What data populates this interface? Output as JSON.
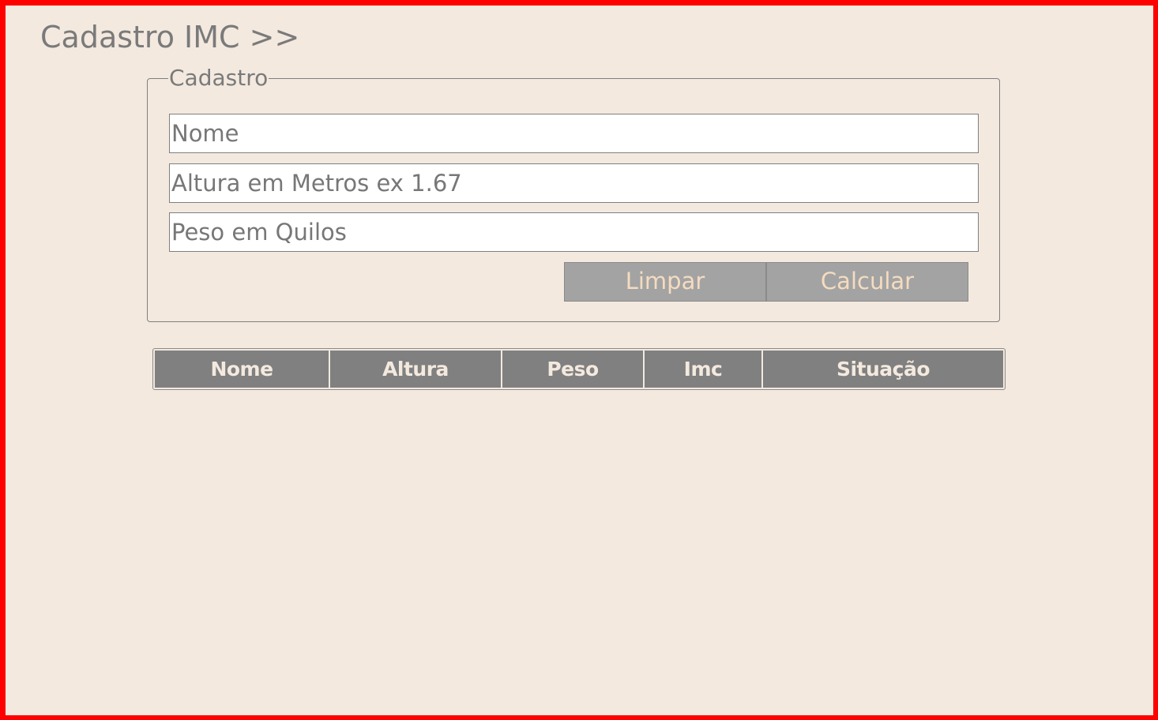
{
  "page": {
    "title": "Cadastro IMC >>"
  },
  "form": {
    "legend": "Cadastro",
    "fields": {
      "nome_placeholder": "Nome",
      "altura_placeholder": "Altura em Metros ex 1.67",
      "peso_placeholder": "Peso em Quilos"
    },
    "buttons": {
      "limpar": "Limpar",
      "calcular": "Calcular"
    }
  },
  "table": {
    "headers": [
      "Nome",
      "Altura",
      "Peso",
      "Imc",
      "Situação"
    ],
    "rows": []
  },
  "colors": {
    "background": "#f3e9df",
    "frame_border": "#ff0000",
    "button_bg": "#a3a3a3",
    "button_text": "#f4dcc0",
    "header_bg": "#808080",
    "text_gray": "#7a7a7a"
  }
}
